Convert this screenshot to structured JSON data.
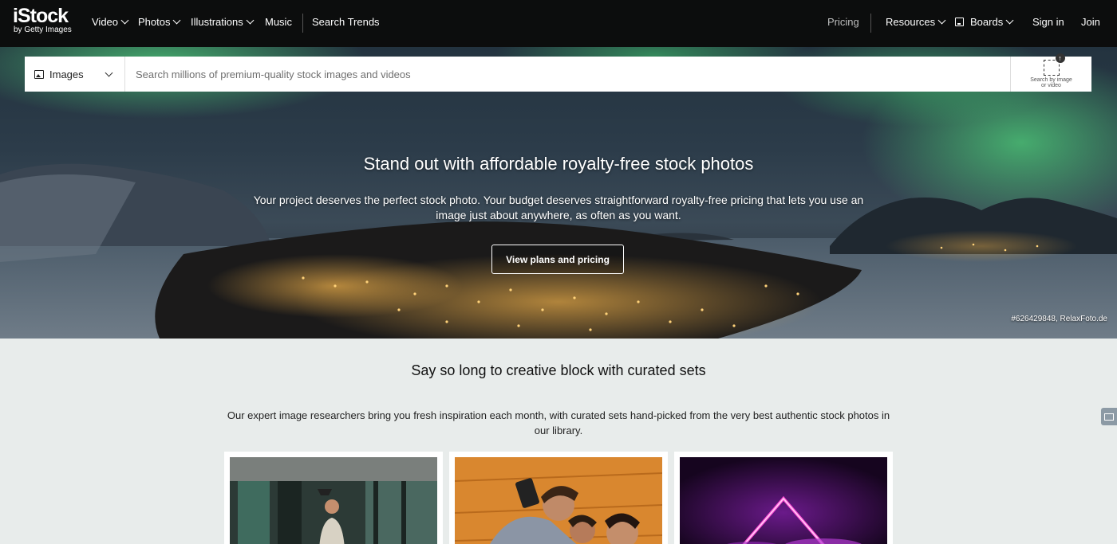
{
  "brand": {
    "logo": "iStock",
    "tagline": "by Getty Images"
  },
  "nav": {
    "left": [
      {
        "label": "Video",
        "dropdown": true
      },
      {
        "label": "Photos",
        "dropdown": true
      },
      {
        "label": "Illustrations",
        "dropdown": true
      },
      {
        "label": "Music",
        "dropdown": false
      }
    ],
    "search_trends": "Search Trends",
    "pricing": "Pricing",
    "resources": "Resources",
    "boards": "Boards",
    "sign_in": "Sign in",
    "join": "Join"
  },
  "search": {
    "type_label": "Images",
    "placeholder": "Search millions of premium-quality stock images and videos",
    "visual_search_label_1": "Search by image",
    "visual_search_label_2": "or video"
  },
  "hero": {
    "title": "Stand out with affordable royalty-free stock photos",
    "subtitle": "Your project deserves the perfect stock photo. Your budget deserves straightforward royalty-free pricing that lets you use an image just about anywhere, as often as you want.",
    "cta": "View plans and pricing",
    "credit": "#626429848, RelaxFoto.de"
  },
  "curated": {
    "title": "Say so long to creative block with curated sets",
    "subtitle": "Our expert image researchers bring you fresh inspiration each month, with curated sets hand-picked from the very best authentic stock photos in our library."
  },
  "colors": {
    "nav_bg": "#0c0d0d",
    "section_bg": "#e8eceb",
    "aurora": "#4fd17a"
  }
}
